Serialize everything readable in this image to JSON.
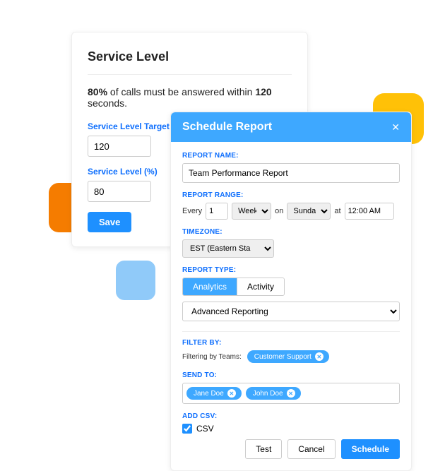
{
  "service_level": {
    "title": "Service Level",
    "desc_prefix": "80%",
    "desc_mid": " of calls must be answered within ",
    "desc_suffix": "120",
    "desc_end": " seconds.",
    "target_label": "Service Level Target (seconds)",
    "target_value": "120",
    "pct_label": "Service Level (%)",
    "pct_value": "80",
    "save_label": "Save"
  },
  "schedule": {
    "title": "Schedule Report",
    "name_label": "REPORT NAME:",
    "name_value": "Team Performance Report",
    "range_label": "REPORT RANGE:",
    "every": "Every",
    "num_value": "1",
    "period_value": "Week",
    "on": "on",
    "day_value": "Sunday",
    "at": "at",
    "time_value": "12:00 AM",
    "tz_label": "TIMEZONE:",
    "tz_value": "EST (Eastern Sta",
    "type_label": "REPORT TYPE:",
    "tab_analytics": "Analytics",
    "tab_activity": "Activity",
    "advanced_value": "Advanced Reporting",
    "filter_label": "FILTER BY:",
    "filter_small": "Filtering by Teams:",
    "filter_chip": "Customer Support",
    "sendto_label": "SEND TO:",
    "sendto_chips": [
      "Jane Doe",
      "John Doe"
    ],
    "csv_label": "ADD CSV:",
    "csv_text": "CSV",
    "test_label": "Test",
    "cancel_label": "Cancel",
    "schedule_label": "Schedule"
  }
}
